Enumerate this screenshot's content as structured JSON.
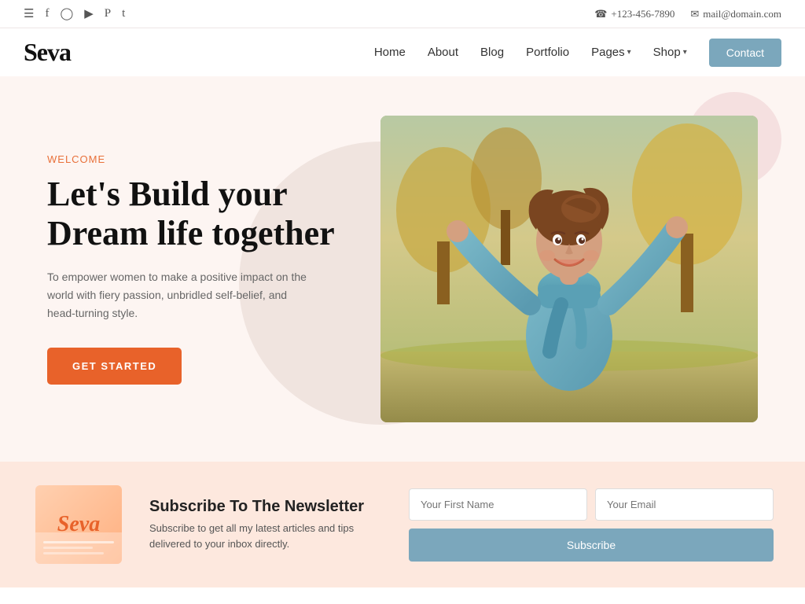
{
  "topbar": {
    "phone": "+123-456-7890",
    "email": "mail@domain.com",
    "social_icons": [
      "hamburger",
      "facebook",
      "instagram",
      "youtube",
      "pinterest",
      "twitter"
    ]
  },
  "navbar": {
    "logo": "Seva",
    "links": [
      {
        "label": "Home",
        "id": "home"
      },
      {
        "label": "About",
        "id": "about"
      },
      {
        "label": "Blog",
        "id": "blog"
      },
      {
        "label": "Portfolio",
        "id": "portfolio"
      },
      {
        "label": "Pages",
        "id": "pages",
        "hasDropdown": true
      },
      {
        "label": "Shop",
        "id": "shop",
        "hasDropdown": true
      }
    ],
    "contact_label": "Contact"
  },
  "hero": {
    "welcome": "Welcome",
    "title": "Let's Build your\nDream life together",
    "description": "To empower women to make a positive impact on the world with fiery passion, unbridled self-belief, and head-turning style.",
    "cta_label": "GET STARTED"
  },
  "newsletter": {
    "logo": "Seva",
    "title": "Subscribe To The Newsletter",
    "description": "Subscribe to get all my latest articles and tips delivered to your inbox directly.",
    "first_name_placeholder": "Your First Name",
    "email_placeholder": "Your Email",
    "subscribe_label": "Subscribe"
  }
}
